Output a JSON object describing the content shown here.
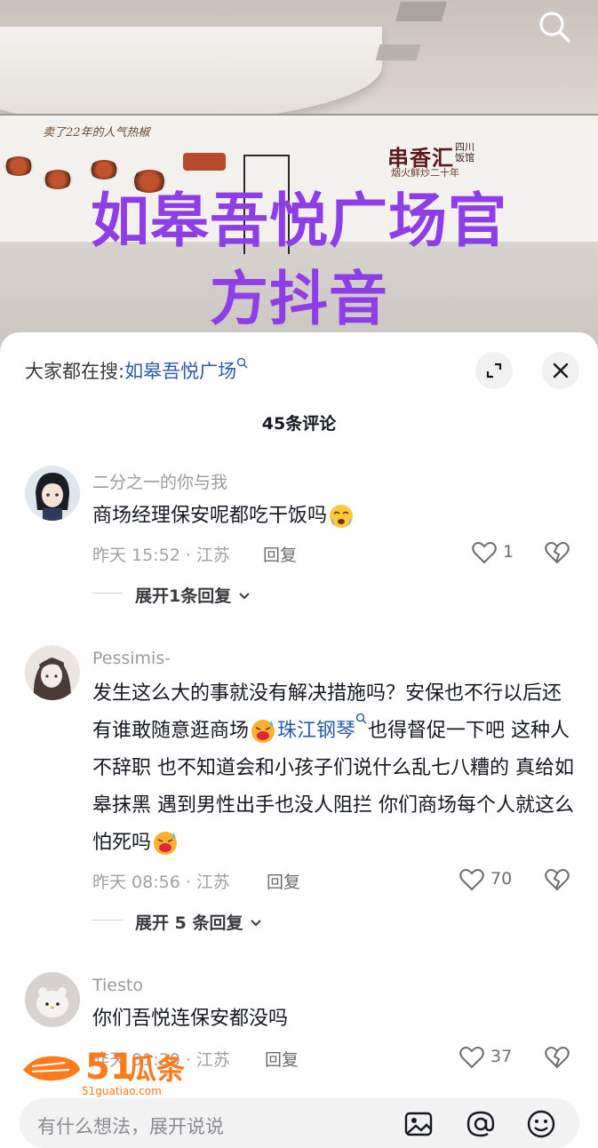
{
  "video": {
    "overlay_title_line1": "如皋吾悦广场官",
    "overlay_title_line2": "方抖音",
    "wall_slogan": "卖了22年的人气热椒",
    "brand_logo": "串香汇",
    "brand_side": "四川饭馆",
    "brand_sub": "烟火鲜炒二十年",
    "search_icon": "search-icon"
  },
  "sheet": {
    "search_hint_prefix": "大家都在搜:",
    "search_hint_link": "如皋吾悦广场",
    "comment_count": "45条评论",
    "expand_icon": "expand-icon",
    "close_icon": "close-icon"
  },
  "comments": [
    {
      "username": "二分之一的你与我",
      "text": "商场经理保安呢都吃干饭吗",
      "emoji": "crying-face-emoji",
      "time_location": "昨天 15:52 · 江苏",
      "reply_label": "回复",
      "likes": "1",
      "more_replies": "展开1条回复"
    },
    {
      "username": "Pessimis-",
      "text_part1": "发生这么大的事就没有解决措施吗？安保也不行以后还有谁敢随意逛商场",
      "topic_link": "珠江钢琴",
      "text_part2": "也得督促一下吧 这种人不辞职 也不知道会和小孩子们说什么乱七八糟的 真给如皋抹黑 遇到男性出手也没人阻拦 你们商场每个人就这么怕死吗",
      "emoji": "sweat-face-emoji",
      "time_location": "昨天 08:56 · 江苏",
      "reply_label": "回复",
      "likes": "70",
      "more_replies": "展开 5 条回复"
    },
    {
      "username": "Tiesto",
      "text": "你们吾悦连保安都没吗",
      "time_location": "昨天 01:30 · 江苏",
      "reply_label": "回复",
      "likes": "37"
    }
  ],
  "watermark": {
    "brand": "51瓜条",
    "url": "51guatiao.com"
  },
  "input_bar": {
    "placeholder": "有什么想法，展开说说",
    "icons": [
      "image-icon",
      "at-icon",
      "emoji-icon"
    ]
  },
  "colors": {
    "overlay_title": "#8d3ee6",
    "link": "#2b5aa8",
    "muted": "#a0a0a5",
    "watermark": "#ff7a1a"
  }
}
